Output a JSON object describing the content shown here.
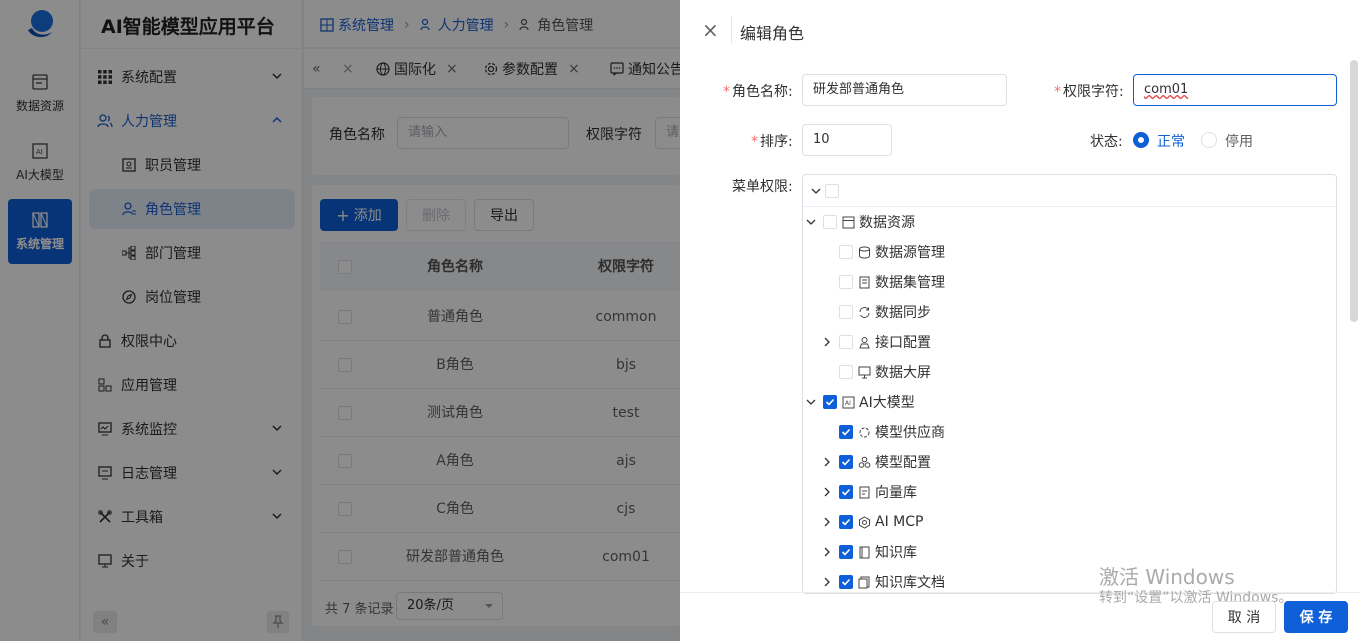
{
  "rail": {
    "items": [
      {
        "label": "数据资源",
        "icon": "database-icon"
      },
      {
        "label": "AI大模型",
        "icon": "ai-icon"
      },
      {
        "label": "系统管理",
        "icon": "system-icon"
      }
    ]
  },
  "sidebar": {
    "title": "AI智能模型应用平台",
    "items": [
      {
        "label": "系统配置",
        "icon": "grid-icon"
      },
      {
        "label": "人力管理",
        "icon": "users-icon"
      },
      {
        "label": "职员管理",
        "icon": "id-card-icon"
      },
      {
        "label": "角色管理",
        "icon": "user-role-icon"
      },
      {
        "label": "部门管理",
        "icon": "org-icon"
      },
      {
        "label": "岗位管理",
        "icon": "compass-icon"
      },
      {
        "label": "权限中心",
        "icon": "lock-icon"
      },
      {
        "label": "应用管理",
        "icon": "app-icon"
      },
      {
        "label": "系统监控",
        "icon": "monitor-icon"
      },
      {
        "label": "日志管理",
        "icon": "log-icon"
      },
      {
        "label": "工具箱",
        "icon": "tools-icon"
      },
      {
        "label": "关于",
        "icon": "about-icon"
      }
    ]
  },
  "breadcrumb": [
    "系统管理",
    "人力管理",
    "角色管理"
  ],
  "tabs": [
    "国际化",
    "参数配置",
    "通知公告"
  ],
  "search": {
    "role_name_label": "角色名称",
    "role_name_placeholder": "请输入",
    "perm_label": "权限字符",
    "perm_placeholder": "请"
  },
  "toolbar": {
    "add": "添加",
    "delete": "删除",
    "export": "导出"
  },
  "table": {
    "headers": [
      "角色名称",
      "权限字符"
    ],
    "rows": [
      {
        "name": "普通角色",
        "key": "common"
      },
      {
        "name": "B角色",
        "key": "bjs"
      },
      {
        "name": "测试角色",
        "key": "test"
      },
      {
        "name": "A角色",
        "key": "ajs"
      },
      {
        "name": "C角色",
        "key": "cjs"
      },
      {
        "name": "研发部普通角色",
        "key": "com01"
      }
    ],
    "total": "共 7 条记录",
    "page_size": "20条/页"
  },
  "drawer": {
    "title": "编辑角色",
    "role_name_label": "角色名称:",
    "role_name_value": "研发部普通角色",
    "perm_label": "权限字符:",
    "perm_value": "com01",
    "sort_label": "排序:",
    "sort_value": "10",
    "status_label": "状态:",
    "status_normal": "正常",
    "status_disabled": "停用",
    "menu_perm_label": "菜单权限:",
    "tree": [
      {
        "label": "数据资源",
        "level": 0,
        "checked": false,
        "expanded": true,
        "icon": "database-icon"
      },
      {
        "label": "数据源管理",
        "level": 1,
        "checked": false,
        "icon": "datasource-icon"
      },
      {
        "label": "数据集管理",
        "level": 1,
        "checked": false,
        "icon": "dataset-icon"
      },
      {
        "label": "数据同步",
        "level": 1,
        "checked": false,
        "icon": "sync-icon"
      },
      {
        "label": "接口配置",
        "level": 1,
        "checked": false,
        "expandable": true,
        "icon": "api-icon"
      },
      {
        "label": "数据大屏",
        "level": 1,
        "checked": false,
        "icon": "screen-icon"
      },
      {
        "label": "AI大模型",
        "level": 0,
        "checked": true,
        "expanded": true,
        "icon": "ai-icon"
      },
      {
        "label": "模型供应商",
        "level": 1,
        "checked": true,
        "icon": "vendor-icon"
      },
      {
        "label": "模型配置",
        "level": 1,
        "checked": true,
        "expandable": true,
        "icon": "model-config-icon"
      },
      {
        "label": "向量库",
        "level": 1,
        "checked": true,
        "expandable": true,
        "icon": "vector-icon"
      },
      {
        "label": "AI MCP",
        "level": 1,
        "checked": true,
        "expandable": true,
        "icon": "mcp-icon"
      },
      {
        "label": "知识库",
        "level": 1,
        "checked": true,
        "expandable": true,
        "icon": "kb-icon"
      },
      {
        "label": "知识库文档",
        "level": 1,
        "checked": true,
        "expandable": true,
        "icon": "kb-doc-icon"
      }
    ],
    "cancel": "取 消",
    "save": "保 存"
  },
  "watermark": {
    "line1": "激活 Windows",
    "line2": "转到“设置”以激活 Windows。"
  },
  "colors": {
    "primary": "#0e5fd8",
    "required": "#f56c6c"
  }
}
